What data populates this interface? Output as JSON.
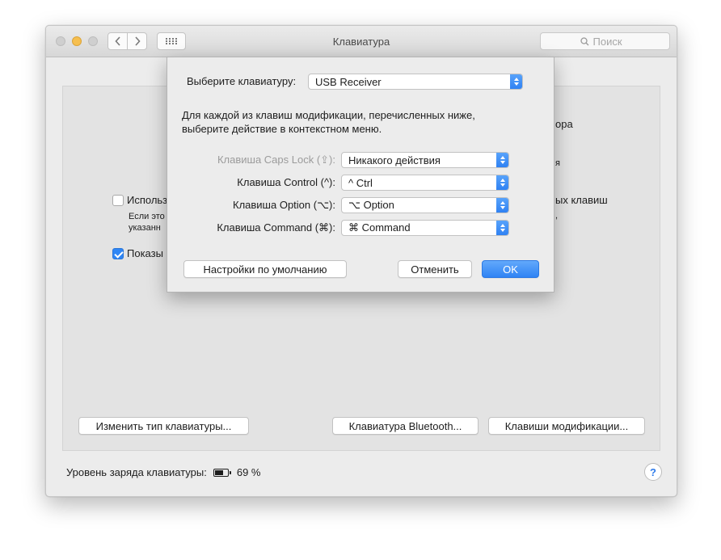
{
  "window": {
    "title": "Клавиатура",
    "search_placeholder": "Поиск"
  },
  "background": {
    "fragment_use": "Использ",
    "fragment_if_line1": "Если это",
    "fragment_if_line2": "указанн",
    "fragment_show": "Показы",
    "fragment_right1": "ора",
    "fragment_right2": "я",
    "fragment_right3": "ых клавиш",
    "fragment_right4": ",",
    "fragment_right5": "",
    "buttons": {
      "change_type": "Изменить тип клавиатуры...",
      "bluetooth": "Клавиатура Bluetooth...",
      "modifier_keys": "Клавиши модификации..."
    },
    "battery_label": "Уровень заряда клавиатуры:",
    "battery_percent": "69 %",
    "battery_level": 0.69,
    "help": "?"
  },
  "sheet": {
    "select_keyboard_label": "Выберите клавиатуру:",
    "selected_keyboard": "USB Receiver",
    "description_line1": "Для каждой из клавиш модификации, перечисленных ниже,",
    "description_line2": "выберите действие в контекстном меню.",
    "rows": [
      {
        "label": "Клавиша Caps Lock (⇪):",
        "value": "Никакого действия"
      },
      {
        "label": "Клавиша Control (^):",
        "value": "^ Ctrl"
      },
      {
        "label": "Клавиша Option (⌥):",
        "value": "⌥ Option"
      },
      {
        "label": "Клавиша Command (⌘):",
        "value": "⌘ Command"
      }
    ],
    "buttons": {
      "defaults": "Настройки по умолчанию",
      "cancel": "Отменить",
      "ok": "OK"
    }
  },
  "colors": {
    "accent": "#2f83f4",
    "window_bg": "#ececec"
  }
}
